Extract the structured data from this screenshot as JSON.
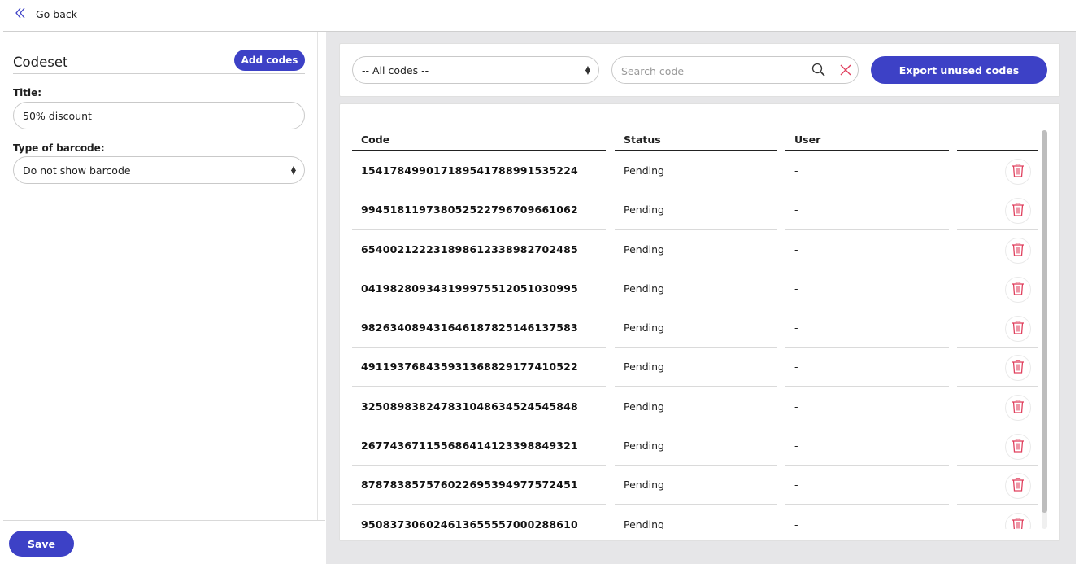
{
  "header": {
    "back_label": "Go back"
  },
  "codeset": {
    "heading": "Codeset",
    "add_codes_label": "Add codes",
    "title_label": "Title:",
    "title_value": "50% discount",
    "barcode_label": "Type of barcode:",
    "barcode_value": "Do not show barcode",
    "save_label": "Save"
  },
  "filters": {
    "code_filter_value": "-- All codes --",
    "search_placeholder": "Search code",
    "export_label": "Export unused codes"
  },
  "table": {
    "columns": [
      "Code",
      "Status",
      "User",
      ""
    ],
    "rows": [
      {
        "code": "15417849901718954178899153522​4",
        "status": "Pending",
        "user": "-"
      },
      {
        "code": "99451811973805252279670966106​2",
        "status": "Pending",
        "user": "-"
      },
      {
        "code": "65400212223189861233898270248​5",
        "status": "Pending",
        "user": "-"
      },
      {
        "code": "04198280934319997551205103099​5",
        "status": "Pending",
        "user": "-"
      },
      {
        "code": "98263408943164618782514613758​3",
        "status": "Pending",
        "user": "-"
      },
      {
        "code": "49119376843593136882917741052​2",
        "status": "Pending",
        "user": "-"
      },
      {
        "code": "32508983824783104863452454584​8",
        "status": "Pending",
        "user": "-"
      },
      {
        "code": "26774367115568641412339884932​1",
        "status": "Pending",
        "user": "-"
      },
      {
        "code": "87878385757602269539497757245​1",
        "status": "Pending",
        "user": "-"
      },
      {
        "code": "95083730602461365555700028861​0",
        "status": "Pending",
        "user": "-"
      }
    ]
  },
  "colors": {
    "primary": "#3d41c6",
    "danger": "#e0405e",
    "panel_bg": "#e6e6e8"
  },
  "icons": {
    "back": "double-chevron-left-icon",
    "search": "magnifier-icon",
    "clear": "close-icon",
    "delete": "trash-icon"
  }
}
